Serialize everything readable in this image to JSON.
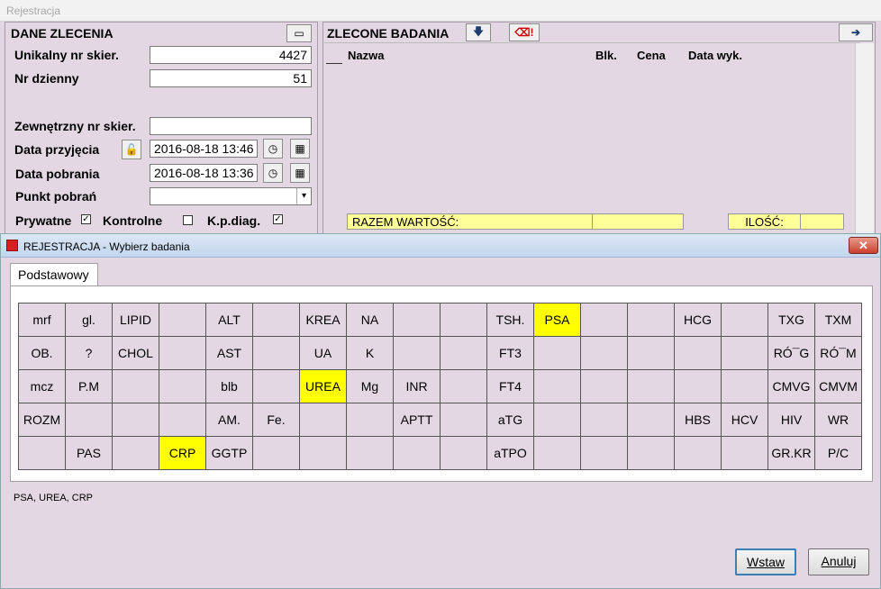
{
  "background_window": {
    "title": "Rejestracja",
    "left_panel": {
      "title": "DANE ZLECENIA",
      "fields": {
        "unikalny_label": "Unikalny nr skier.",
        "unikalny_value": "4427",
        "dzienny_label": "Nr dzienny",
        "dzienny_value": "51",
        "zewnetrzny_label": "Zewnętrzny nr skier.",
        "zewnetrzny_value": "",
        "przyjecia_label": "Data przyjęcia",
        "przyjecia_value": "2016-08-18 13:46",
        "pobrania_label": "Data pobrania",
        "pobrania_value": "2016-08-18 13:36",
        "punkt_label": "Punkt pobrań",
        "punkt_value": ""
      },
      "checks": {
        "prywatne_label": "Prywatne",
        "prywatne_checked": true,
        "kontrolne_label": "Kontrolne",
        "kontrolne_checked": false,
        "kpdiag_label": "K.p.diag.",
        "kpdiag_checked": true
      }
    },
    "right_panel": {
      "title": "ZLECONE BADANIA",
      "columns": [
        "Nazwa",
        "Blk.",
        "Cena",
        "Data wyk."
      ],
      "razem_label": "RAZEM WARTOŚĆ:",
      "razem_value": "",
      "ilosc_label": "ILOŚĆ:",
      "ilosc_value": ""
    }
  },
  "dialog": {
    "title": "REJESTRACJA - Wybierz badania",
    "close_glyph": "✕",
    "tab_label": "Podstawowy",
    "grid": [
      [
        "mrf",
        "gl.",
        "LIPID",
        "",
        "ALT",
        "",
        "KREA",
        "NA",
        "",
        "",
        "TSH.",
        "PSA",
        "",
        "",
        "HCG",
        "",
        "TXG",
        "TXM"
      ],
      [
        "OB.",
        "?",
        "CHOL",
        "",
        "AST",
        "",
        "UA",
        "K",
        "",
        "",
        "FT3",
        "",
        "",
        "",
        "",
        "",
        "RÓ¯G",
        "RÓ¯M"
      ],
      [
        "mcz",
        "P.M",
        "",
        "",
        "blb",
        "",
        "UREA",
        "Mg",
        "INR",
        "",
        "FT4",
        "",
        "",
        "",
        "",
        "",
        "CMVG",
        "CMVM"
      ],
      [
        "ROZM",
        "",
        "",
        "",
        "AM.",
        "Fe.",
        "",
        "",
        "APTT",
        "",
        "aTG",
        "",
        "",
        "",
        "HBS",
        "HCV",
        "HIV",
        "WR"
      ],
      [
        "",
        "PAS",
        "",
        "CRP",
        "GGTP",
        "",
        "",
        "",
        "",
        "",
        "aTPO",
        "",
        "",
        "",
        "",
        "",
        "GR.KR",
        "P/C"
      ]
    ],
    "selected": [
      "PSA",
      "UREA",
      "CRP"
    ],
    "summary": "PSA, UREA, CRP",
    "insert_button": "Wstaw",
    "cancel_button": "Anuluj"
  },
  "colors": {
    "selected_cell": "#ffff00",
    "cell_bg": "#e3d7e4",
    "totals_bg": "#ffff99"
  }
}
